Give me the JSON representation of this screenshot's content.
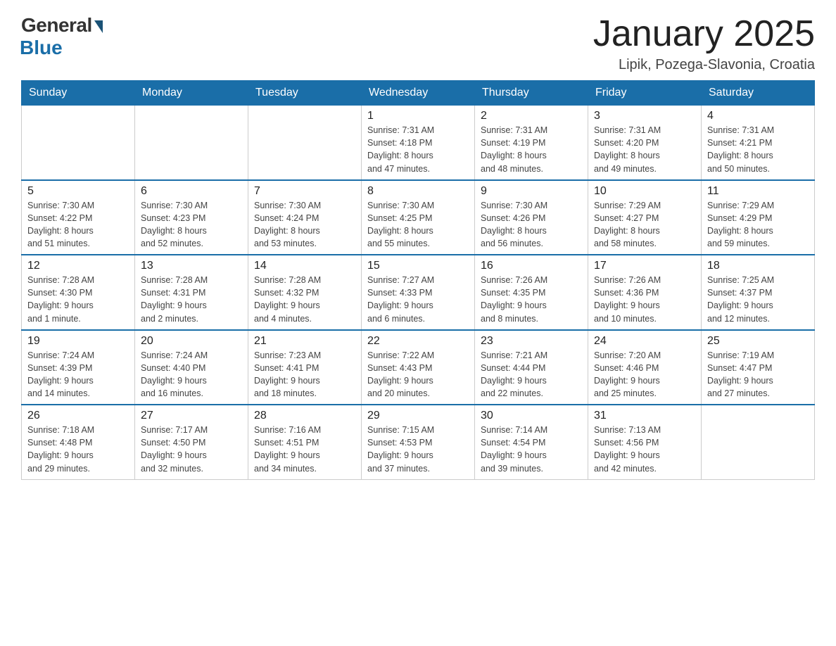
{
  "logo": {
    "general": "General",
    "blue": "Blue"
  },
  "title": "January 2025",
  "location": "Lipik, Pozega-Slavonia, Croatia",
  "days_of_week": [
    "Sunday",
    "Monday",
    "Tuesday",
    "Wednesday",
    "Thursday",
    "Friday",
    "Saturday"
  ],
  "weeks": [
    [
      {
        "day": "",
        "info": ""
      },
      {
        "day": "",
        "info": ""
      },
      {
        "day": "",
        "info": ""
      },
      {
        "day": "1",
        "info": "Sunrise: 7:31 AM\nSunset: 4:18 PM\nDaylight: 8 hours\nand 47 minutes."
      },
      {
        "day": "2",
        "info": "Sunrise: 7:31 AM\nSunset: 4:19 PM\nDaylight: 8 hours\nand 48 minutes."
      },
      {
        "day": "3",
        "info": "Sunrise: 7:31 AM\nSunset: 4:20 PM\nDaylight: 8 hours\nand 49 minutes."
      },
      {
        "day": "4",
        "info": "Sunrise: 7:31 AM\nSunset: 4:21 PM\nDaylight: 8 hours\nand 50 minutes."
      }
    ],
    [
      {
        "day": "5",
        "info": "Sunrise: 7:30 AM\nSunset: 4:22 PM\nDaylight: 8 hours\nand 51 minutes."
      },
      {
        "day": "6",
        "info": "Sunrise: 7:30 AM\nSunset: 4:23 PM\nDaylight: 8 hours\nand 52 minutes."
      },
      {
        "day": "7",
        "info": "Sunrise: 7:30 AM\nSunset: 4:24 PM\nDaylight: 8 hours\nand 53 minutes."
      },
      {
        "day": "8",
        "info": "Sunrise: 7:30 AM\nSunset: 4:25 PM\nDaylight: 8 hours\nand 55 minutes."
      },
      {
        "day": "9",
        "info": "Sunrise: 7:30 AM\nSunset: 4:26 PM\nDaylight: 8 hours\nand 56 minutes."
      },
      {
        "day": "10",
        "info": "Sunrise: 7:29 AM\nSunset: 4:27 PM\nDaylight: 8 hours\nand 58 minutes."
      },
      {
        "day": "11",
        "info": "Sunrise: 7:29 AM\nSunset: 4:29 PM\nDaylight: 8 hours\nand 59 minutes."
      }
    ],
    [
      {
        "day": "12",
        "info": "Sunrise: 7:28 AM\nSunset: 4:30 PM\nDaylight: 9 hours\nand 1 minute."
      },
      {
        "day": "13",
        "info": "Sunrise: 7:28 AM\nSunset: 4:31 PM\nDaylight: 9 hours\nand 2 minutes."
      },
      {
        "day": "14",
        "info": "Sunrise: 7:28 AM\nSunset: 4:32 PM\nDaylight: 9 hours\nand 4 minutes."
      },
      {
        "day": "15",
        "info": "Sunrise: 7:27 AM\nSunset: 4:33 PM\nDaylight: 9 hours\nand 6 minutes."
      },
      {
        "day": "16",
        "info": "Sunrise: 7:26 AM\nSunset: 4:35 PM\nDaylight: 9 hours\nand 8 minutes."
      },
      {
        "day": "17",
        "info": "Sunrise: 7:26 AM\nSunset: 4:36 PM\nDaylight: 9 hours\nand 10 minutes."
      },
      {
        "day": "18",
        "info": "Sunrise: 7:25 AM\nSunset: 4:37 PM\nDaylight: 9 hours\nand 12 minutes."
      }
    ],
    [
      {
        "day": "19",
        "info": "Sunrise: 7:24 AM\nSunset: 4:39 PM\nDaylight: 9 hours\nand 14 minutes."
      },
      {
        "day": "20",
        "info": "Sunrise: 7:24 AM\nSunset: 4:40 PM\nDaylight: 9 hours\nand 16 minutes."
      },
      {
        "day": "21",
        "info": "Sunrise: 7:23 AM\nSunset: 4:41 PM\nDaylight: 9 hours\nand 18 minutes."
      },
      {
        "day": "22",
        "info": "Sunrise: 7:22 AM\nSunset: 4:43 PM\nDaylight: 9 hours\nand 20 minutes."
      },
      {
        "day": "23",
        "info": "Sunrise: 7:21 AM\nSunset: 4:44 PM\nDaylight: 9 hours\nand 22 minutes."
      },
      {
        "day": "24",
        "info": "Sunrise: 7:20 AM\nSunset: 4:46 PM\nDaylight: 9 hours\nand 25 minutes."
      },
      {
        "day": "25",
        "info": "Sunrise: 7:19 AM\nSunset: 4:47 PM\nDaylight: 9 hours\nand 27 minutes."
      }
    ],
    [
      {
        "day": "26",
        "info": "Sunrise: 7:18 AM\nSunset: 4:48 PM\nDaylight: 9 hours\nand 29 minutes."
      },
      {
        "day": "27",
        "info": "Sunrise: 7:17 AM\nSunset: 4:50 PM\nDaylight: 9 hours\nand 32 minutes."
      },
      {
        "day": "28",
        "info": "Sunrise: 7:16 AM\nSunset: 4:51 PM\nDaylight: 9 hours\nand 34 minutes."
      },
      {
        "day": "29",
        "info": "Sunrise: 7:15 AM\nSunset: 4:53 PM\nDaylight: 9 hours\nand 37 minutes."
      },
      {
        "day": "30",
        "info": "Sunrise: 7:14 AM\nSunset: 4:54 PM\nDaylight: 9 hours\nand 39 minutes."
      },
      {
        "day": "31",
        "info": "Sunrise: 7:13 AM\nSunset: 4:56 PM\nDaylight: 9 hours\nand 42 minutes."
      },
      {
        "day": "",
        "info": ""
      }
    ]
  ]
}
